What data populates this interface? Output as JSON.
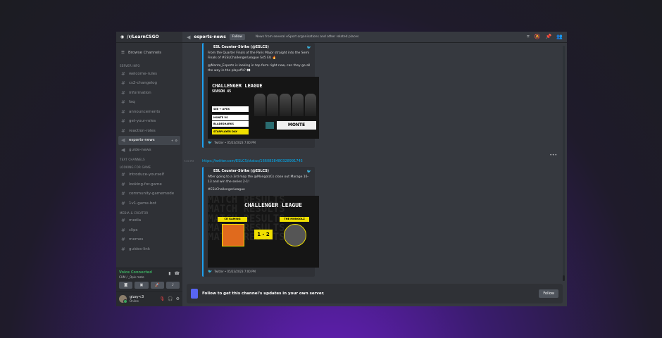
{
  "server": {
    "name": "/r/LearnCSGO"
  },
  "sidebar": {
    "browse_label": "Browse Channels",
    "categories": [
      {
        "name": "SERVER INFO",
        "channels": [
          "welcome-rules",
          "cs2-changelog",
          "information",
          "faq",
          "announcements",
          "get-your-roles",
          "reaction-roles",
          "esports-news",
          "guide-news"
        ]
      },
      {
        "name": "TEXT CHANNELS",
        "channels": []
      },
      {
        "name": "LOOKING FOR GAME",
        "channels": [
          "introduce-yourself",
          "looking-for-game",
          "community-gamemode",
          "1v1-game-bot"
        ]
      },
      {
        "name": "MEDIA & CREATOR",
        "channels": [
          "media",
          "clips",
          "memes",
          "guides-link"
        ]
      }
    ]
  },
  "voice": {
    "title": "Voice Connected",
    "subtitle": "CUM / _Opis mate"
  },
  "user": {
    "name": "gizzy<3",
    "status": "Online"
  },
  "topbar": {
    "channel": "esports-news",
    "follow": "Follow",
    "topic": "News from several eSport organisations and other related places"
  },
  "messages": [
    {
      "author": "ESL Counter-Strike (@ESLCS)",
      "text1": "From the Quarter Finals of the Paris Major straight into the Semi Finals of #ESLChallengerLeague S45 EU 🔥",
      "text2": "@Monte_Esports is looking in top form right now, can they go all the way in the playoffs? 👀",
      "footer": "Twitter • 05/23/2023 7:00 PM",
      "image": {
        "league": "CHALLENGER LEAGUE",
        "season": "SEASON 45",
        "tags": [
          "SEE → APEX",
          "MONTE VS",
          "BLADESHARKS"
        ],
        "ytag": "STARPLAYER DAY",
        "team": "MONTE"
      }
    },
    {
      "time": "7:00 PM",
      "link": "https://twitter.com/ESLCS/status/1660838480328991745",
      "author": "ESL Counter-Strike (@ESLCS)",
      "text1": "After going to a 3rd map the @MongolzCs close out Marage 16-13 and win the series 2-1!",
      "text2": "#ESLChallengerLeague",
      "footer": "Twitter • 05/23/2023 7:00 PM",
      "image": {
        "league": "CHALLENGER LEAGUE",
        "team_a": "CR GAMING",
        "team_b": "THE MONGOLZ",
        "score": "1 - 2",
        "bg": "MATCH RESULTS MATCH RESULTS MATCH RESULTS MATCH RESULTS MATCH RESULTS"
      }
    }
  ],
  "follow_bar": {
    "text": "Follow to get this channel's updates in your own server.",
    "button": "Follow"
  },
  "colors": {
    "accent": "#5865f2",
    "twitter": "#1da1f2",
    "online": "#3ba55d",
    "link": "#00aff4"
  }
}
